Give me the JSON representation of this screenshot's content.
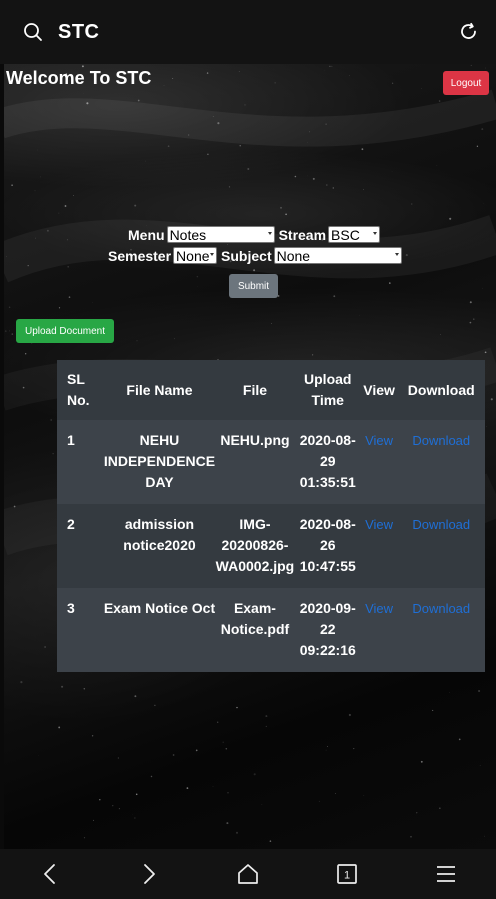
{
  "browser": {
    "site_name": "STC",
    "search_icon": "search-icon",
    "reload_icon": "reload-icon"
  },
  "header": {
    "welcome": "Welcome To STC",
    "logout_label": "Logout"
  },
  "filters": {
    "menu_label": "Menu",
    "menu_value": "Notes",
    "stream_label": "Stream",
    "stream_value": "BSC",
    "semester_label": "Semester",
    "semester_value": "None",
    "subject_label": "Subject",
    "subject_value": "None",
    "submit_label": "Submit"
  },
  "upload_label": "Upload Document",
  "table": {
    "headers": {
      "sl": "SL No.",
      "file_name": "File Name",
      "file": "File",
      "upload_time": "Upload Time",
      "view": "View",
      "download": "Download"
    },
    "rows": [
      {
        "sl": "1",
        "file_name": "NEHU INDEPENDENCE DAY",
        "file": "NEHU.png",
        "upload_time": "2020-08-29 01:35:51",
        "view": "View",
        "download": "Download"
      },
      {
        "sl": "2",
        "file_name": "admission notice2020",
        "file": "IMG-20200826-WA0002.jpg",
        "upload_time": "2020-08-26 10:47:55",
        "view": "View",
        "download": "Download"
      },
      {
        "sl": "3",
        "file_name": "Exam Notice Oct",
        "file": "Exam-Notice.pdf",
        "upload_time": "2020-09-22 09:22:16",
        "view": "View",
        "download": "Download"
      }
    ]
  },
  "bottom_nav": {
    "back_icon": "back-icon",
    "forward_icon": "forward-icon",
    "home_icon": "home-icon",
    "tab_count": "1",
    "menu_icon": "menu-icon"
  },
  "colors": {
    "logout": "#dc3545",
    "submit": "#6c757d",
    "upload": "#28a745",
    "table_dark": "#343a40",
    "link": "#1f6fd6"
  }
}
